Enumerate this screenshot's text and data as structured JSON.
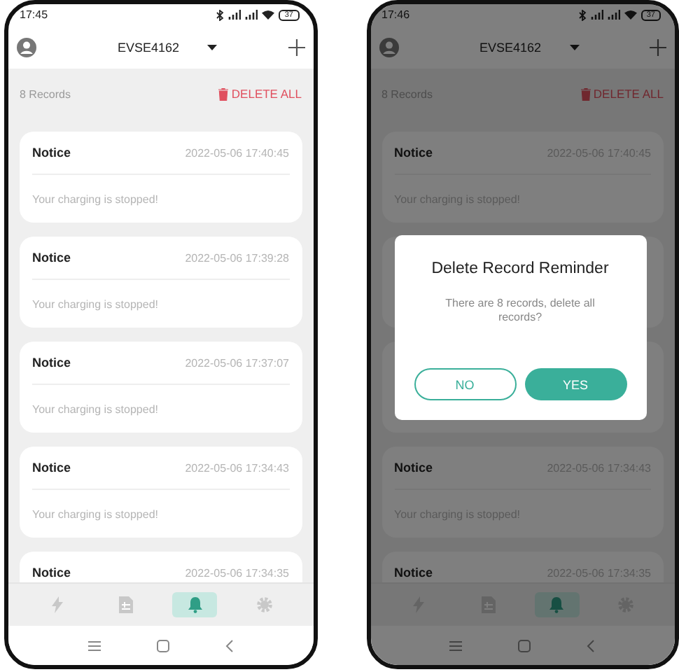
{
  "screens": [
    {
      "status_time": "17:45",
      "battery": "37",
      "device": "EVSE4162",
      "records_count": "8 Records",
      "delete_label": "DELETE ALL",
      "records": [
        {
          "kind": "notice",
          "title": "Notice",
          "time": "2022-05-06 17:40:45",
          "message": "Your charging is stopped!"
        },
        {
          "kind": "notice",
          "title": "Notice",
          "time": "2022-05-06 17:39:28",
          "message": "Your charging is stopped!"
        },
        {
          "kind": "notice",
          "title": "Notice",
          "time": "2022-05-06 17:37:07",
          "message": "Your charging is stopped!"
        },
        {
          "kind": "notice",
          "title": "Notice",
          "time": "2022-05-06 17:34:43",
          "message": "Your charging is stopped!"
        },
        {
          "kind": "notice",
          "title": "Notice",
          "time": "2022-05-06 17:34:35"
        }
      ],
      "tabs": [
        {
          "kind": "bolt",
          "selected": false
        },
        {
          "kind": "document",
          "selected": false
        },
        {
          "kind": "bell",
          "selected": true
        },
        {
          "kind": "gear",
          "selected": false
        }
      ]
    },
    {
      "status_time": "17:46",
      "battery": "37",
      "device": "EVSE4162",
      "records_count": "8 Records",
      "delete_label": "DELETE ALL",
      "records": [
        {
          "kind": "notice",
          "title": "Notice",
          "time": "2022-05-06 17:40:45",
          "message": "Your charging is stopped!"
        },
        {
          "kind": "covered"
        },
        {
          "kind": "covered"
        },
        {
          "kind": "notice",
          "title": "Notice",
          "time": "2022-05-06 17:34:43",
          "message": "Your charging is stopped!"
        },
        {
          "kind": "notice",
          "title": "Notice",
          "time": "2022-05-06 17:34:35"
        }
      ],
      "tabs": [
        {
          "kind": "bolt",
          "selected": false
        },
        {
          "kind": "document",
          "selected": false
        },
        {
          "kind": "bell",
          "selected": true
        },
        {
          "kind": "gear",
          "selected": false
        }
      ],
      "dialog": {
        "title": "Delete Record Reminder",
        "message": "There are 8 records, delete all records?",
        "buttons": [
          {
            "label": "NO",
            "kind": "secondary"
          },
          {
            "label": "YES",
            "kind": "primary"
          }
        ]
      }
    }
  ]
}
